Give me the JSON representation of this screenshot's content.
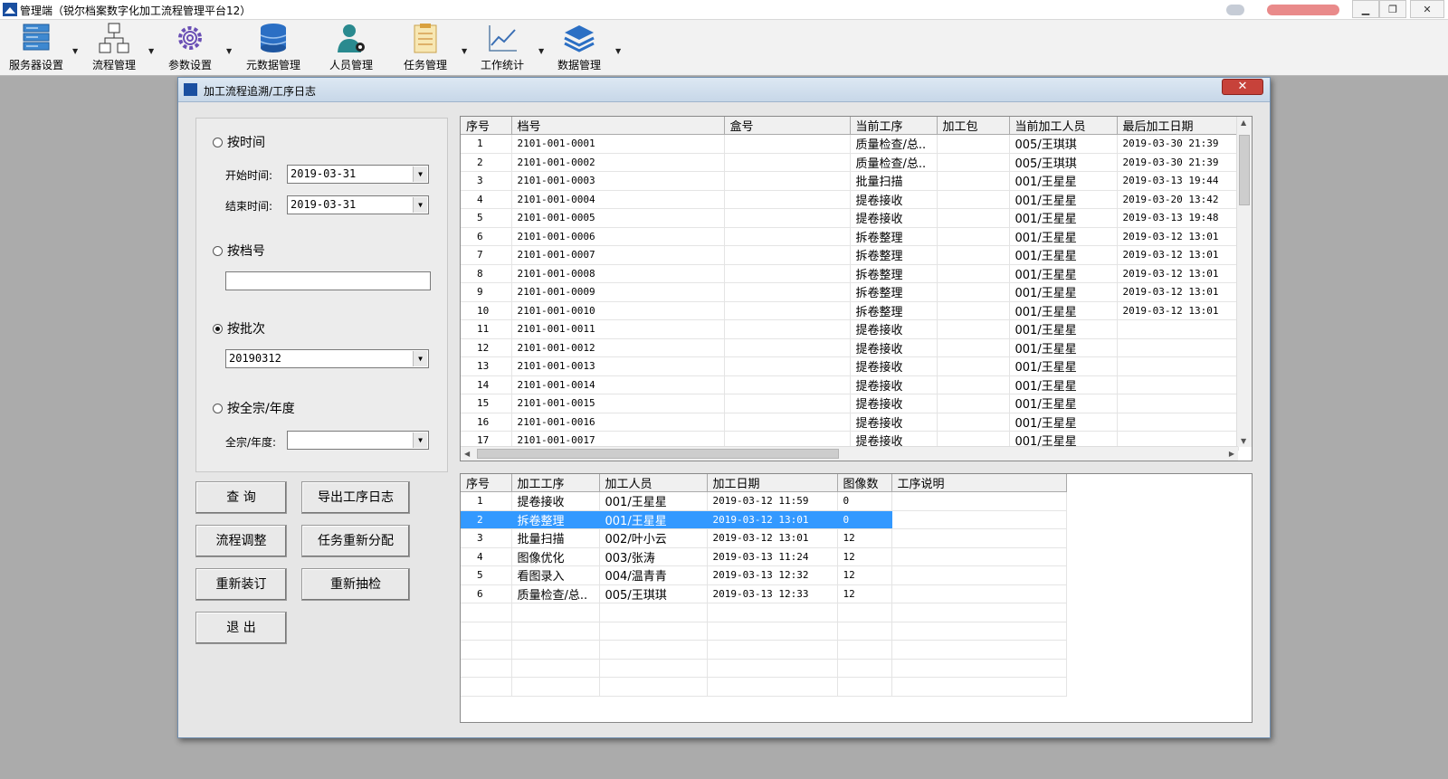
{
  "app": {
    "title": "管理端（锐尔档案数字化加工流程管理平台12）"
  },
  "toolbar": [
    {
      "label": "服务器设置",
      "icon": "server-icon"
    },
    {
      "label": "流程管理",
      "icon": "flowchart-icon"
    },
    {
      "label": "参数设置",
      "icon": "gear-icon"
    },
    {
      "label": "元数据管理",
      "icon": "database-icon"
    },
    {
      "label": "人员管理",
      "icon": "user-gear-icon"
    },
    {
      "label": "任务管理",
      "icon": "clipboard-icon"
    },
    {
      "label": "工作统计",
      "icon": "line-chart-icon"
    },
    {
      "label": "数据管理",
      "icon": "layers-icon"
    }
  ],
  "dialog": {
    "title": "加工流程追溯/工序日志",
    "close": "✕"
  },
  "filter": {
    "by_time": "按时间",
    "start_label": "开始时间:",
    "start_value": "2019-03-31",
    "end_label": "结束时间:",
    "end_value": "2019-03-31",
    "by_archive": "按档号",
    "archive_value": "",
    "by_batch": "按批次",
    "batch_value": "20190312",
    "by_fonds": "按全宗/年度",
    "fonds_label": "全宗/年度:",
    "fonds_value": "",
    "selected": "by_batch"
  },
  "buttons": {
    "query": "查 询",
    "export_log": "导出工序日志",
    "adjust_flow": "流程调整",
    "reassign": "任务重新分配",
    "rebind": "重新装订",
    "resample": "重新抽检",
    "exit": "退 出"
  },
  "top_grid": {
    "columns": [
      "序号",
      "档号",
      "盒号",
      "当前工序",
      "加工包",
      "当前加工人员",
      "最后加工日期"
    ],
    "rows": [
      [
        "1",
        "2101-001-0001",
        "",
        "质量检查/总..",
        "",
        "005/王琪琪",
        "2019-03-30 21:39"
      ],
      [
        "2",
        "2101-001-0002",
        "",
        "质量检查/总..",
        "",
        "005/王琪琪",
        "2019-03-30 21:39"
      ],
      [
        "3",
        "2101-001-0003",
        "",
        "批量扫描",
        "",
        "001/王星星",
        "2019-03-13 19:44"
      ],
      [
        "4",
        "2101-001-0004",
        "",
        "提卷接收",
        "",
        "001/王星星",
        "2019-03-20 13:42"
      ],
      [
        "5",
        "2101-001-0005",
        "",
        "提卷接收",
        "",
        "001/王星星",
        "2019-03-13 19:48"
      ],
      [
        "6",
        "2101-001-0006",
        "",
        "拆卷整理",
        "",
        "001/王星星",
        "2019-03-12 13:01"
      ],
      [
        "7",
        "2101-001-0007",
        "",
        "拆卷整理",
        "",
        "001/王星星",
        "2019-03-12 13:01"
      ],
      [
        "8",
        "2101-001-0008",
        "",
        "拆卷整理",
        "",
        "001/王星星",
        "2019-03-12 13:01"
      ],
      [
        "9",
        "2101-001-0009",
        "",
        "拆卷整理",
        "",
        "001/王星星",
        "2019-03-12 13:01"
      ],
      [
        "10",
        "2101-001-0010",
        "",
        "拆卷整理",
        "",
        "001/王星星",
        "2019-03-12 13:01"
      ],
      [
        "11",
        "2101-001-0011",
        "",
        "提卷接收",
        "",
        "001/王星星",
        ""
      ],
      [
        "12",
        "2101-001-0012",
        "",
        "提卷接收",
        "",
        "001/王星星",
        ""
      ],
      [
        "13",
        "2101-001-0013",
        "",
        "提卷接收",
        "",
        "001/王星星",
        ""
      ],
      [
        "14",
        "2101-001-0014",
        "",
        "提卷接收",
        "",
        "001/王星星",
        ""
      ],
      [
        "15",
        "2101-001-0015",
        "",
        "提卷接收",
        "",
        "001/王星星",
        ""
      ],
      [
        "16",
        "2101-001-0016",
        "",
        "提卷接收",
        "",
        "001/王星星",
        ""
      ],
      [
        "17",
        "2101-001-0017",
        "",
        "提卷接收",
        "",
        "001/王星星",
        ""
      ]
    ]
  },
  "bottom_grid": {
    "columns": [
      "序号",
      "加工工序",
      "加工人员",
      "加工日期",
      "图像数",
      "工序说明"
    ],
    "rows": [
      [
        "1",
        "提卷接收",
        "001/王星星",
        "2019-03-12 11:59",
        "0",
        ""
      ],
      [
        "2",
        "拆卷整理",
        "001/王星星",
        "2019-03-12 13:01",
        "0",
        ""
      ],
      [
        "3",
        "批量扫描",
        "002/叶小云",
        "2019-03-12 13:01",
        "12",
        ""
      ],
      [
        "4",
        "图像优化",
        "003/张涛",
        "2019-03-13 11:24",
        "12",
        ""
      ],
      [
        "5",
        "看图录入",
        "004/温青青",
        "2019-03-13 12:32",
        "12",
        ""
      ],
      [
        "6",
        "质量检查/总..",
        "005/王琪琪",
        "2019-03-13 12:33",
        "12",
        ""
      ]
    ],
    "selected_row": 2
  },
  "colors": {
    "selection": "#3399ff",
    "brand": "#1a4fa0"
  }
}
